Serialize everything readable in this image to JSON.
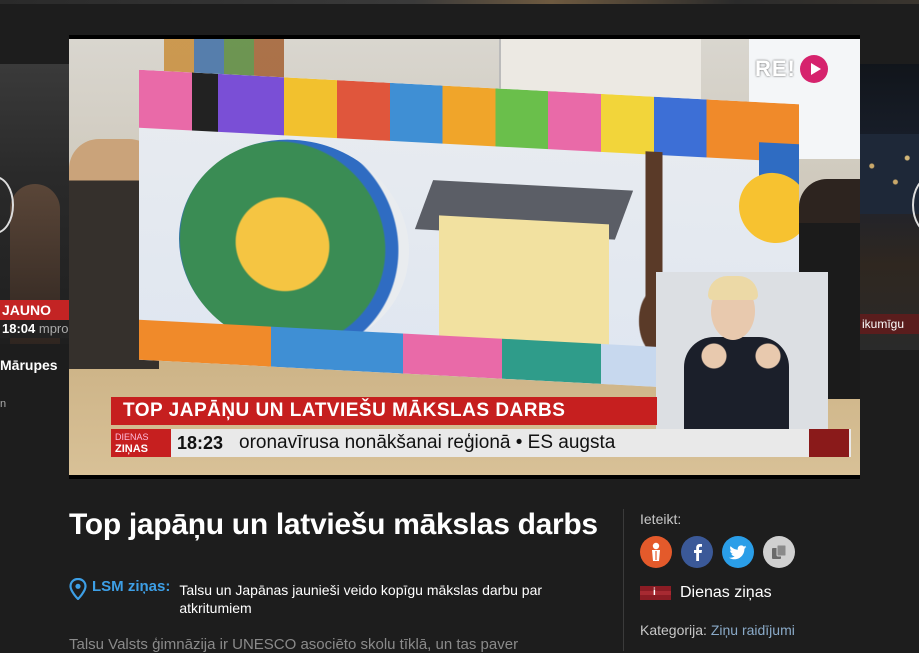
{
  "carousel": {
    "left": {
      "banner": "JAUNO",
      "time": "18:04",
      "ticker": "mpro",
      "title": "Mārupes",
      "sub": "n"
    },
    "right": {
      "banner": "ikumīgu"
    }
  },
  "video": {
    "channel_logo": "RE!",
    "lower_third_title": "TOP JAPĀŅU UN LATVIEŠU MĀKSLAS DARBS",
    "show_badge": "DIENAS",
    "show_badge_2": "ZIŅAS",
    "clock": "18:23",
    "ticker_text": "oronavīrusa nonākšanai reģionā   •   ES augsta"
  },
  "article": {
    "title": "Top japāņu un latviešu mākslas darbs",
    "source_label": "LSM ziņas:",
    "summary": "Talsu un Japānas jaunieši veido kopīgu mākslas darbu par atkritumiem",
    "body_start": "Talsu Valsts ģimnāzija ir UNESCO asociēto skolu tīklā, un tas paver"
  },
  "sidebar": {
    "share_label": "Ieteikt:",
    "share_buttons": [
      "draugiem-icon",
      "facebook-icon",
      "twitter-icon",
      "copy-icon"
    ],
    "show_flag_mark": "i",
    "show_name": "Dienas ziņas",
    "category_label": "Kategorija:",
    "category_value": "Ziņu raidījumi"
  },
  "colors": {
    "background": "#1d1d1d",
    "accent_red": "#c61f1f",
    "link_blue": "#3d9fe6",
    "share_orange": "#e45a2b",
    "share_facebook": "#3b5998",
    "share_twitter": "#2a9ee8",
    "logo_pink": "#d6236d"
  }
}
